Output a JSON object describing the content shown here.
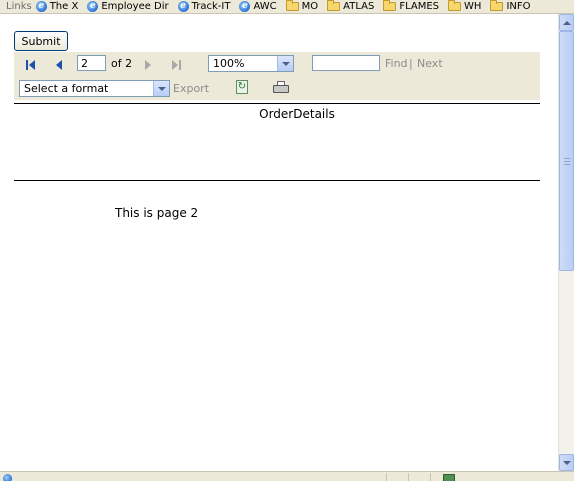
{
  "links_bar": {
    "label": "Links",
    "items": [
      {
        "label": "The X",
        "icon": "ie-page-icon"
      },
      {
        "label": "Employee Dir",
        "icon": "ie-page-icon"
      },
      {
        "label": "Track-IT",
        "icon": "ie-page-icon"
      },
      {
        "label": "AWC",
        "icon": "ie-page-icon"
      },
      {
        "label": "MO",
        "icon": "folder-icon"
      },
      {
        "label": "ATLAS",
        "icon": "folder-icon"
      },
      {
        "label": "FLAMES",
        "icon": "folder-icon"
      },
      {
        "label": "WH",
        "icon": "folder-icon"
      },
      {
        "label": "INFO",
        "icon": "folder-icon"
      }
    ]
  },
  "form": {
    "submit_label": "Submit"
  },
  "toolbar": {
    "page_value": "2",
    "of_label": "of 2",
    "zoom_value": "100%",
    "find_value": "",
    "find_label": "Find",
    "separator": "|",
    "next_label": "Next",
    "format_value": "Select a format",
    "export_label": "Export"
  },
  "report": {
    "title": "OrderDetails",
    "page_text": "This is page 2"
  },
  "colors": {
    "toolbar_bg": "#ece9d8",
    "disabled_text": "#8c8c8c",
    "nav_active": "#1f4fa8",
    "nav_disabled": "#a9a9a9"
  }
}
